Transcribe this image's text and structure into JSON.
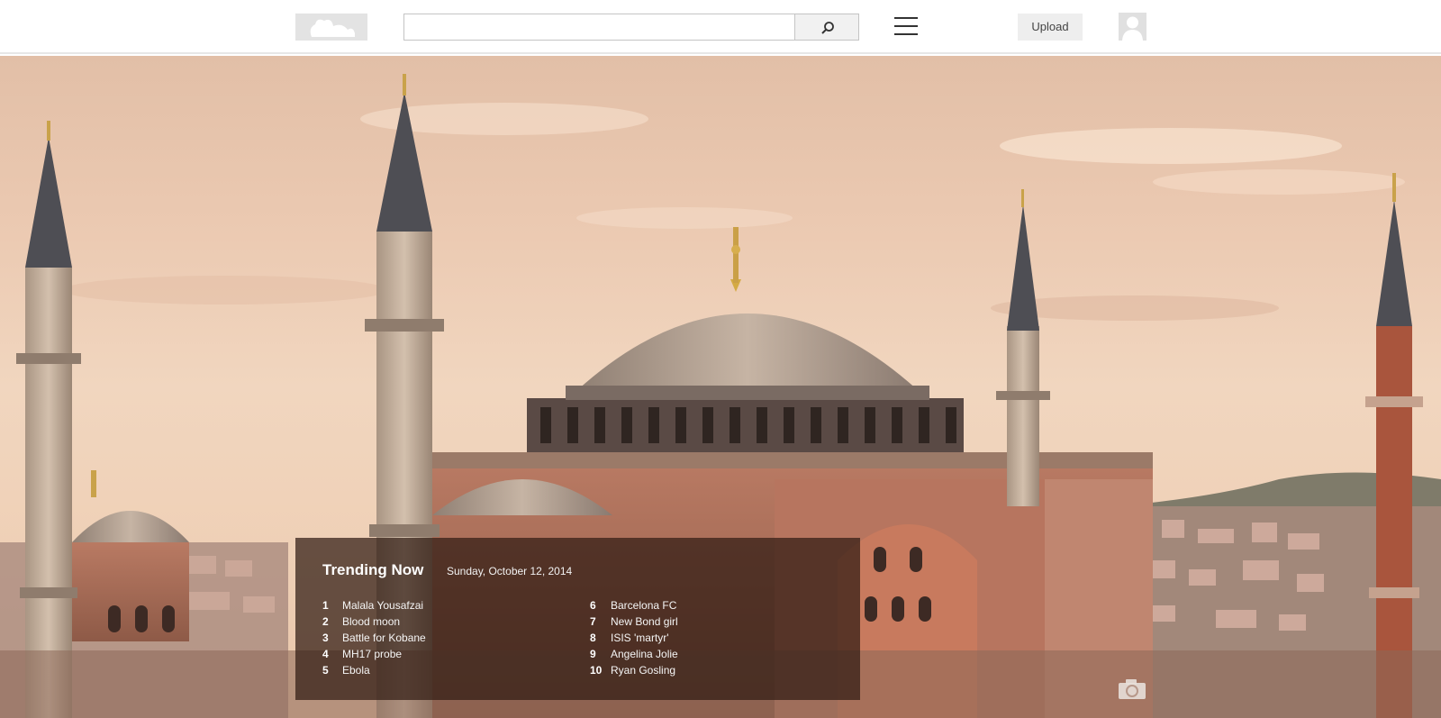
{
  "header": {
    "logo": {
      "icon": "logo-placeholder-icon"
    },
    "search": {
      "placeholder": "",
      "value": "",
      "button_icon": "search-icon"
    },
    "menu_icon": "hamburger-menu-icon",
    "upload_label": "Upload",
    "avatar_icon": "user-silhouette-icon"
  },
  "hero": {
    "image": "hagia-sophia-photo",
    "camera_icon": "camera-icon"
  },
  "trending": {
    "title": "Trending Now",
    "date": "Sunday, October 12, 2014",
    "items": [
      {
        "rank": "1",
        "label": "Malala Yousafzai"
      },
      {
        "rank": "2",
        "label": "Blood moon"
      },
      {
        "rank": "3",
        "label": "Battle for Kobane"
      },
      {
        "rank": "4",
        "label": "MH17 probe"
      },
      {
        "rank": "5",
        "label": "Ebola"
      },
      {
        "rank": "6",
        "label": "Barcelona FC"
      },
      {
        "rank": "7",
        "label": "New Bond girl"
      },
      {
        "rank": "8",
        "label": "ISIS 'martyr'"
      },
      {
        "rank": "9",
        "label": "Angelina Jolie"
      },
      {
        "rank": "10",
        "label": "Ryan Gosling"
      }
    ]
  },
  "colors": {
    "header_bg": "#ffffff",
    "panel_bg": "#301c14",
    "sky": "#ebc9b1"
  }
}
